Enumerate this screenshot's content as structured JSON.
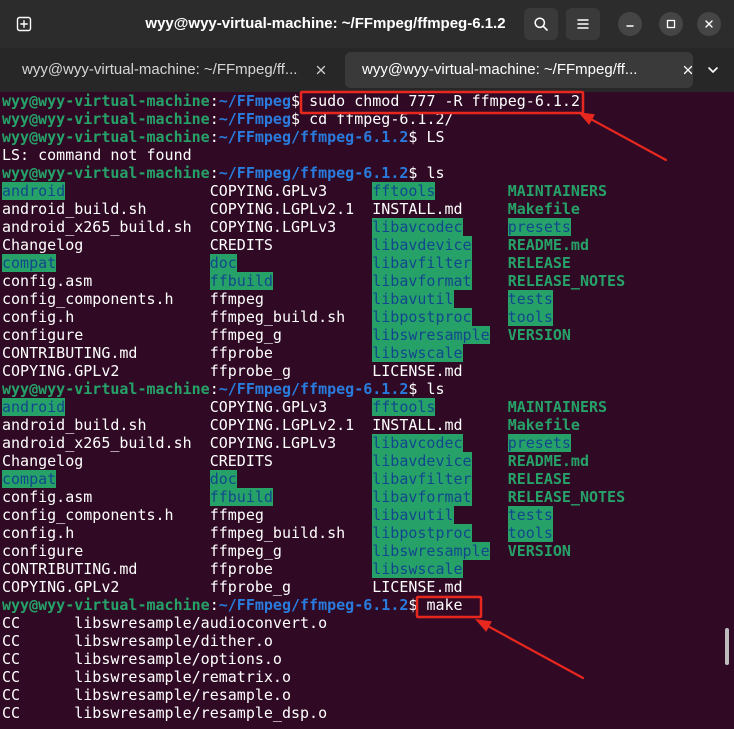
{
  "window": {
    "title": "wyy@wyy-virtual-machine: ~/FFmpeg/ffmpeg-6.1.2",
    "icons": {
      "new_tab": "new-tab-icon",
      "search": "search-icon",
      "menu": "hamburger-menu-icon",
      "minimize": "minimize-icon",
      "maximize": "maximize-icon",
      "close": "close-icon"
    }
  },
  "tabs": {
    "items": [
      {
        "label": "wyy@wyy-virtual-machine: ~/FFmpeg/ff...",
        "active": false,
        "close_icon": "close-icon"
      },
      {
        "label": "wyy@wyy-virtual-machine: ~/FFmpeg/ff...",
        "active": true,
        "close_icon": "close-icon"
      }
    ],
    "overflow_icon": "chevron-down-icon"
  },
  "terminal": {
    "user_host": "wyy@wyy-virtual-machine",
    "separator": ":",
    "prompt_symbol": "$",
    "lines": [
      {
        "type": "prompt",
        "cwd": "~/FFmpeg",
        "command": "sudo chmod 777 -R ffmpeg-6.1.2"
      },
      {
        "type": "prompt",
        "cwd": "~/FFmpeg",
        "command": "cd ffmpeg-6.1.2/"
      },
      {
        "type": "prompt",
        "cwd": "~/FFmpeg/ffmpeg-6.1.2",
        "command": "LS"
      },
      {
        "type": "output",
        "text": "LS: command not found"
      },
      {
        "type": "prompt",
        "cwd": "~/FFmpeg/ffmpeg-6.1.2",
        "command": "ls"
      },
      {
        "type": "ls",
        "cells": [
          {
            "name": "android",
            "style": "dir"
          },
          {
            "name": "COPYING.GPLv3",
            "style": "file"
          },
          {
            "name": "fftools",
            "style": "dir"
          },
          {
            "name": "MAINTAINERS",
            "style": "exec"
          }
        ]
      },
      {
        "type": "ls",
        "cells": [
          {
            "name": "android_build.sh",
            "style": "file"
          },
          {
            "name": "COPYING.LGPLv2.1",
            "style": "file"
          },
          {
            "name": "INSTALL.md",
            "style": "file"
          },
          {
            "name": "Makefile",
            "style": "exec"
          }
        ]
      },
      {
        "type": "ls",
        "cells": [
          {
            "name": "android_x265_build.sh",
            "style": "file"
          },
          {
            "name": "COPYING.LGPLv3",
            "style": "file"
          },
          {
            "name": "libavcodec",
            "style": "dir"
          },
          {
            "name": "presets",
            "style": "dir"
          }
        ]
      },
      {
        "type": "ls",
        "cells": [
          {
            "name": "Changelog",
            "style": "file"
          },
          {
            "name": "CREDITS",
            "style": "file"
          },
          {
            "name": "libavdevice",
            "style": "dir"
          },
          {
            "name": "README.md",
            "style": "exec"
          }
        ]
      },
      {
        "type": "ls",
        "cells": [
          {
            "name": "compat",
            "style": "dir"
          },
          {
            "name": "doc",
            "style": "dir"
          },
          {
            "name": "libavfilter",
            "style": "dir"
          },
          {
            "name": "RELEASE",
            "style": "exec"
          }
        ]
      },
      {
        "type": "ls",
        "cells": [
          {
            "name": "config.asm",
            "style": "file"
          },
          {
            "name": "ffbuild",
            "style": "dir"
          },
          {
            "name": "libavformat",
            "style": "dir"
          },
          {
            "name": "RELEASE_NOTES",
            "style": "exec"
          }
        ]
      },
      {
        "type": "ls",
        "cells": [
          {
            "name": "config_components.h",
            "style": "file"
          },
          {
            "name": "ffmpeg",
            "style": "file"
          },
          {
            "name": "libavutil",
            "style": "dir"
          },
          {
            "name": "tests",
            "style": "dir"
          }
        ]
      },
      {
        "type": "ls",
        "cells": [
          {
            "name": "config.h",
            "style": "file"
          },
          {
            "name": "ffmpeg_build.sh",
            "style": "file"
          },
          {
            "name": "libpostproc",
            "style": "dir"
          },
          {
            "name": "tools",
            "style": "dir"
          }
        ]
      },
      {
        "type": "ls",
        "cells": [
          {
            "name": "configure",
            "style": "file"
          },
          {
            "name": "ffmpeg_g",
            "style": "file"
          },
          {
            "name": "libswresample",
            "style": "dir"
          },
          {
            "name": "VERSION",
            "style": "exec"
          }
        ]
      },
      {
        "type": "ls",
        "cells": [
          {
            "name": "CONTRIBUTING.md",
            "style": "file"
          },
          {
            "name": "ffprobe",
            "style": "file"
          },
          {
            "name": "libswscale",
            "style": "dir"
          }
        ]
      },
      {
        "type": "ls",
        "cells": [
          {
            "name": "COPYING.GPLv2",
            "style": "file"
          },
          {
            "name": "ffprobe_g",
            "style": "file"
          },
          {
            "name": "LICENSE.md",
            "style": "file"
          }
        ]
      },
      {
        "type": "prompt",
        "cwd": "~/FFmpeg/ffmpeg-6.1.2",
        "command": "ls"
      },
      {
        "type": "ls",
        "cells": [
          {
            "name": "android",
            "style": "dir"
          },
          {
            "name": "COPYING.GPLv3",
            "style": "file"
          },
          {
            "name": "fftools",
            "style": "dir"
          },
          {
            "name": "MAINTAINERS",
            "style": "exec"
          }
        ]
      },
      {
        "type": "ls",
        "cells": [
          {
            "name": "android_build.sh",
            "style": "file"
          },
          {
            "name": "COPYING.LGPLv2.1",
            "style": "file"
          },
          {
            "name": "INSTALL.md",
            "style": "file"
          },
          {
            "name": "Makefile",
            "style": "exec"
          }
        ]
      },
      {
        "type": "ls",
        "cells": [
          {
            "name": "android_x265_build.sh",
            "style": "file"
          },
          {
            "name": "COPYING.LGPLv3",
            "style": "file"
          },
          {
            "name": "libavcodec",
            "style": "dir"
          },
          {
            "name": "presets",
            "style": "dir"
          }
        ]
      },
      {
        "type": "ls",
        "cells": [
          {
            "name": "Changelog",
            "style": "file"
          },
          {
            "name": "CREDITS",
            "style": "file"
          },
          {
            "name": "libavdevice",
            "style": "dir"
          },
          {
            "name": "README.md",
            "style": "exec"
          }
        ]
      },
      {
        "type": "ls",
        "cells": [
          {
            "name": "compat",
            "style": "dir"
          },
          {
            "name": "doc",
            "style": "dir"
          },
          {
            "name": "libavfilter",
            "style": "dir"
          },
          {
            "name": "RELEASE",
            "style": "exec"
          }
        ]
      },
      {
        "type": "ls",
        "cells": [
          {
            "name": "config.asm",
            "style": "file"
          },
          {
            "name": "ffbuild",
            "style": "dir"
          },
          {
            "name": "libavformat",
            "style": "dir"
          },
          {
            "name": "RELEASE_NOTES",
            "style": "exec"
          }
        ]
      },
      {
        "type": "ls",
        "cells": [
          {
            "name": "config_components.h",
            "style": "file"
          },
          {
            "name": "ffmpeg",
            "style": "file"
          },
          {
            "name": "libavutil",
            "style": "dir"
          },
          {
            "name": "tests",
            "style": "dir"
          }
        ]
      },
      {
        "type": "ls",
        "cells": [
          {
            "name": "config.h",
            "style": "file"
          },
          {
            "name": "ffmpeg_build.sh",
            "style": "file"
          },
          {
            "name": "libpostproc",
            "style": "dir"
          },
          {
            "name": "tools",
            "style": "dir"
          }
        ]
      },
      {
        "type": "ls",
        "cells": [
          {
            "name": "configure",
            "style": "file"
          },
          {
            "name": "ffmpeg_g",
            "style": "file"
          },
          {
            "name": "libswresample",
            "style": "dir"
          },
          {
            "name": "VERSION",
            "style": "exec"
          }
        ]
      },
      {
        "type": "ls",
        "cells": [
          {
            "name": "CONTRIBUTING.md",
            "style": "file"
          },
          {
            "name": "ffprobe",
            "style": "file"
          },
          {
            "name": "libswscale",
            "style": "dir"
          }
        ]
      },
      {
        "type": "ls",
        "cells": [
          {
            "name": "COPYING.GPLv2",
            "style": "file"
          },
          {
            "name": "ffprobe_g",
            "style": "file"
          },
          {
            "name": "LICENSE.md",
            "style": "file"
          }
        ]
      },
      {
        "type": "prompt",
        "cwd": "~/FFmpeg/ffmpeg-6.1.2",
        "command": "make"
      },
      {
        "type": "build",
        "tag": "CC",
        "target": "libswresample/audioconvert.o"
      },
      {
        "type": "build",
        "tag": "CC",
        "target": "libswresample/dither.o"
      },
      {
        "type": "build",
        "tag": "CC",
        "target": "libswresample/options.o"
      },
      {
        "type": "build",
        "tag": "CC",
        "target": "libswresample/rematrix.o"
      },
      {
        "type": "build",
        "tag": "CC",
        "target": "libswresample/resample.o"
      },
      {
        "type": "build",
        "tag": "CC",
        "target": "libswresample/resample_dsp.o"
      }
    ]
  },
  "colors": {
    "titlebar": "#2c2c2c",
    "tabbar": "#272727",
    "active_tab": "#3a3a3a",
    "terminal_background": "#300a24",
    "terminal_text": "#ffffff",
    "prompt_user": "#26a269",
    "prompt_cwd": "#2a7bde",
    "dir_highlight_bg": "#26a269",
    "dir_highlight_text": "#12488b",
    "executable_text": "#26a269",
    "annotation_red": "#e8281e"
  }
}
